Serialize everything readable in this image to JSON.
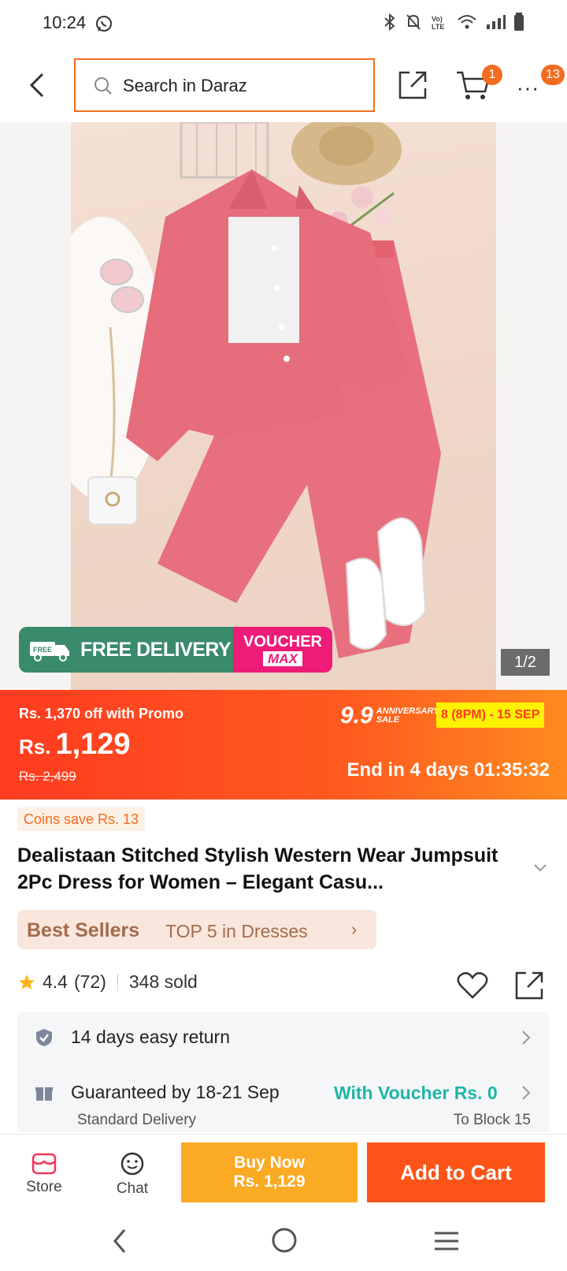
{
  "status_bar": {
    "time": "10:24"
  },
  "header": {
    "search_placeholder": "Search in Daraz",
    "cart_badge": "1",
    "more_badge": "13"
  },
  "gallery": {
    "free_delivery_label": "FREE DELIVERY",
    "free_tag": "FREE",
    "voucher_label": "VOUCHER",
    "voucher_max": "MAX",
    "counter": "1/2"
  },
  "price_banner": {
    "promo_text": "Rs. 1,370 off with Promo",
    "currency": "Rs.",
    "price": "1,129",
    "original_price": "Rs. 2,499",
    "sale_number": "9.9",
    "sale_tag_line1": "ANNIVERSARY",
    "sale_tag_line2": "SALE",
    "sale_dates": "8 (8PM) - 15 SEP",
    "countdown": "End in 4 days 01:35:32",
    "colors": {
      "start": "#ff3b20",
      "end": "#ff8a20",
      "date_bg": "#fff200"
    }
  },
  "product": {
    "coins_badge": "Coins save Rs. 13",
    "title": "Dealistaan Stitched Stylish Western Wear Jumpsuit 2Pc Dress for Women – Elegant Casu...",
    "best_sellers_label": "Best Sellers",
    "best_sellers_rank": "TOP 5 in Dresses",
    "rating": "4.4",
    "reviews": "(72)",
    "sold": "348 sold"
  },
  "services": {
    "return_text": "14 days easy return",
    "guarantee_text": "Guaranteed by 18-21 Sep",
    "voucher_text": "With Voucher Rs. 0",
    "delivery_type": "Standard Delivery",
    "delivery_location": "To Block 15"
  },
  "bottom_bar": {
    "store_label": "Store",
    "chat_label": "Chat",
    "buy_now_label": "Buy Now",
    "buy_now_price": "Rs. 1,129",
    "add_to_cart_label": "Add to Cart",
    "colors": {
      "buy_now": "#fbaa24",
      "add_to_cart": "#fc5418",
      "accent": "#f36d21"
    }
  }
}
